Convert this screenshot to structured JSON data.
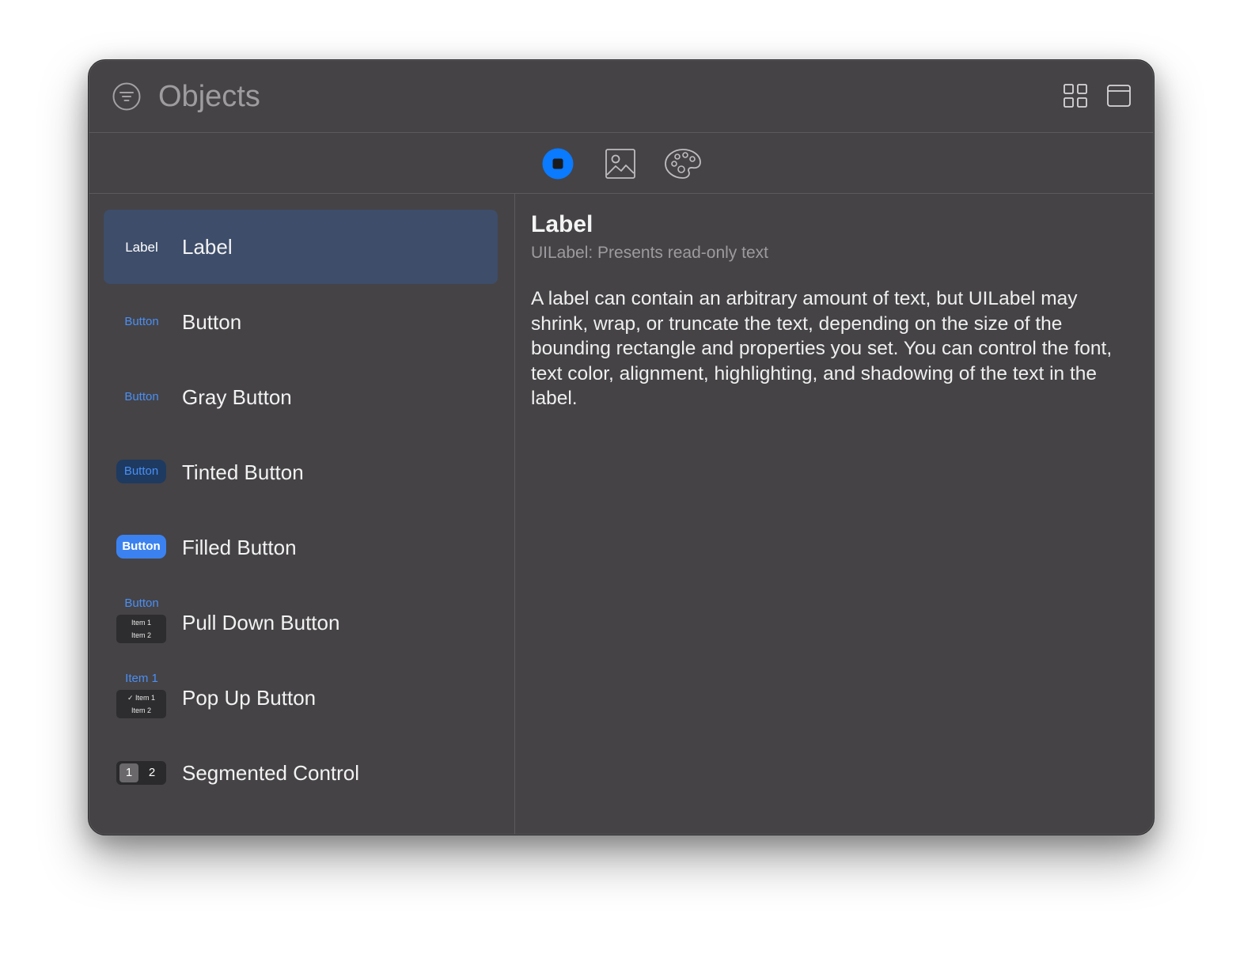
{
  "header": {
    "title": "Objects",
    "filter_icon": "filter-icon",
    "grid_icon": "grid-view-icon",
    "window_icon": "window-icon"
  },
  "toolbar": {
    "tabs": [
      {
        "icon": "objects-icon",
        "selected": true
      },
      {
        "icon": "image-icon",
        "selected": false
      },
      {
        "icon": "palette-icon",
        "selected": false
      }
    ]
  },
  "colors": {
    "accent": "#0a7aff",
    "selection": "#3d4d6a",
    "window_bg": "#454346"
  },
  "list": {
    "items": [
      {
        "label": "Label",
        "thumb": "Label"
      },
      {
        "label": "Button",
        "thumb": "Button"
      },
      {
        "label": "Gray Button",
        "thumb": "Button"
      },
      {
        "label": "Tinted Button",
        "thumb": "Button"
      },
      {
        "label": "Filled Button",
        "thumb": "Button"
      },
      {
        "label": "Pull Down Button",
        "thumb": "Button",
        "menu_items": [
          "Item 1",
          "Item 2"
        ]
      },
      {
        "label": "Pop Up Button",
        "thumb": "Item 1",
        "menu_items": [
          "✓ Item 1",
          "Item 2"
        ]
      },
      {
        "label": "Segmented Control",
        "segments": [
          "1",
          "2"
        ]
      }
    ]
  },
  "detail": {
    "title": "Label",
    "subtitle": "UILabel: Presents read-only text",
    "body": "A label can contain an arbitrary amount of text, but UILabel may shrink, wrap, or truncate the text, depending on the size of the bounding rectangle and properties you set. You can control the font, text color, alignment, highlighting, and shadowing of the text in the label."
  }
}
